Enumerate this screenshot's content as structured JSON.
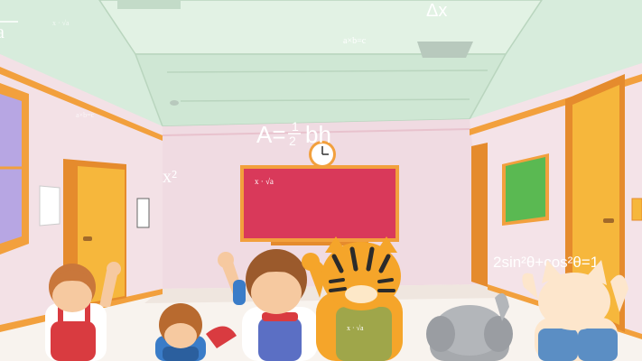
{
  "formulas": {
    "a_corner": "a",
    "x_dot_sqrt": "x · √a",
    "delta_x": "Δx",
    "axb": "a×b=c",
    "area_a": "A=",
    "area_half": "1",
    "area_half_den": "2",
    "area_bh": "bh",
    "x_sq": "x²",
    "trig": "2sin²θ+cos²θ=1",
    "small_ab": "a×b=c",
    "chalk": "x · √a",
    "bag": "x · √a"
  },
  "colors": {
    "wall": "#f3dfe4",
    "ceiling": "#d7ecdc",
    "trim": "#f2a03d",
    "board": "#d9395a",
    "door": "#f6b73c",
    "floor": "#f8f3ee"
  }
}
